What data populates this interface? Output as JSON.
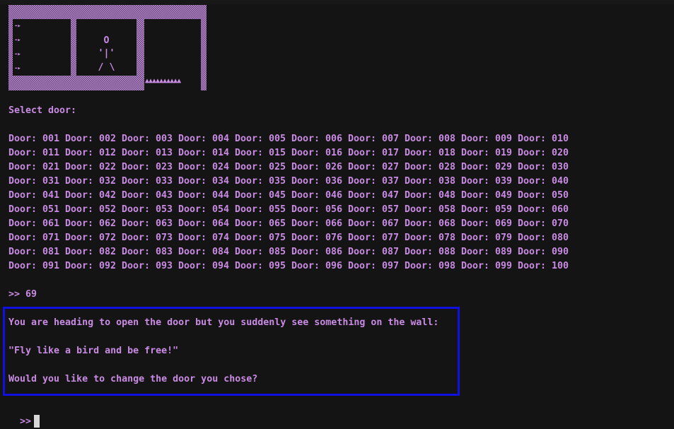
{
  "scene": {
    "arrows": [
      "-▸",
      "-▸",
      "-▸",
      "-▸"
    ],
    "stick_figure": [
      "O",
      "'|'",
      "/ \\"
    ],
    "spikes": "▲▲▲▲▲▲▲▲▲▲"
  },
  "prompt_select": "Select door:",
  "door_label": "Door:",
  "doors": [
    [
      "001",
      "002",
      "003",
      "004",
      "005",
      "006",
      "007",
      "008",
      "009",
      "010"
    ],
    [
      "011",
      "012",
      "013",
      "014",
      "015",
      "016",
      "017",
      "018",
      "019",
      "020"
    ],
    [
      "021",
      "022",
      "023",
      "024",
      "025",
      "026",
      "027",
      "028",
      "029",
      "030"
    ],
    [
      "031",
      "032",
      "033",
      "034",
      "035",
      "036",
      "037",
      "038",
      "039",
      "040"
    ],
    [
      "041",
      "042",
      "043",
      "044",
      "045",
      "046",
      "047",
      "048",
      "049",
      "050"
    ],
    [
      "051",
      "052",
      "053",
      "054",
      "055",
      "056",
      "057",
      "058",
      "059",
      "060"
    ],
    [
      "061",
      "062",
      "063",
      "064",
      "065",
      "066",
      "067",
      "068",
      "069",
      "070"
    ],
    [
      "071",
      "072",
      "073",
      "074",
      "075",
      "076",
      "077",
      "078",
      "079",
      "080"
    ],
    [
      "081",
      "082",
      "083",
      "084",
      "085",
      "086",
      "087",
      "088",
      "089",
      "090"
    ],
    [
      "091",
      "092",
      "093",
      "094",
      "095",
      "096",
      "097",
      "098",
      "099",
      "100"
    ]
  ],
  "first_input": ">> 69",
  "message": {
    "line1": "You are heading to open the door but you suddenly see something on the wall:",
    "line2": "\"Fly like a bird and be free!\"",
    "line3": "Would you like to change the door you chose?"
  },
  "input_prompt": ">>",
  "colors": {
    "background": "#141414",
    "text": "#c98be3",
    "highlight_border": "#1010e0"
  }
}
